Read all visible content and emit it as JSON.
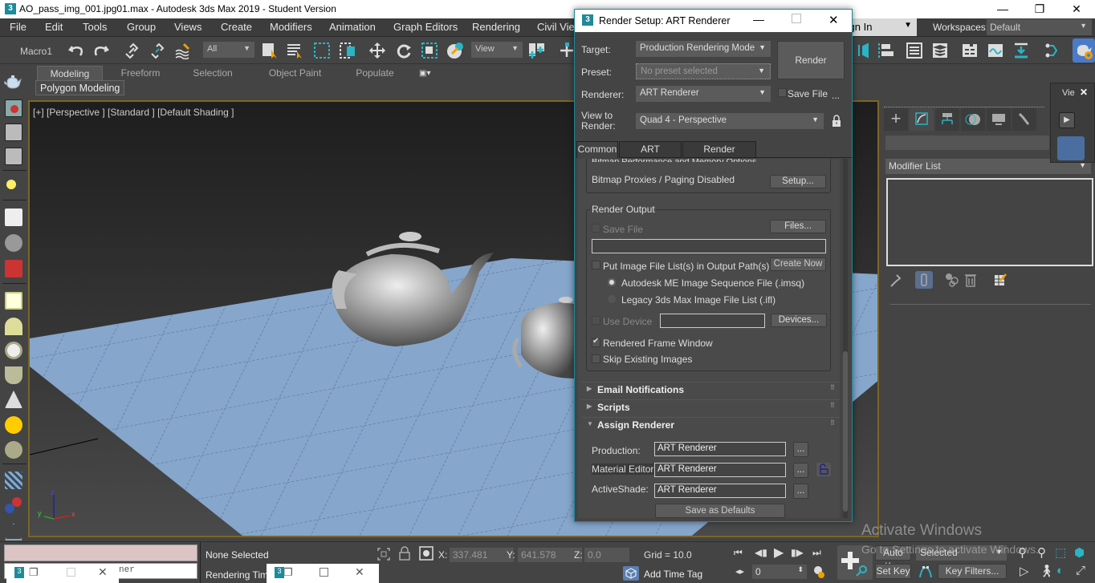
{
  "window": {
    "title": "AO_pass_img_001.jpg01.max - Autodesk 3ds Max 2019 - Student Version",
    "app_icon": "3",
    "minimize": "—",
    "restore": "❐",
    "close": "✕"
  },
  "menubar": {
    "items": [
      "File",
      "Edit",
      "Tools",
      "Group",
      "Views",
      "Create",
      "Modifiers",
      "Animation",
      "Graph Editors",
      "Rendering",
      "Civil View"
    ],
    "sign_in": "Sign In",
    "workspaces_label": "Workspaces:",
    "workspaces_value": "Default"
  },
  "toolbar": {
    "macro_label": "Macro1",
    "selection_filter": "All",
    "ref_coord": "View"
  },
  "ribbon": {
    "tabs": [
      "Modeling",
      "Freeform",
      "Selection",
      "Object Paint",
      "Populate"
    ],
    "active_tab": "Modeling",
    "sub_label": "Polygon Modeling"
  },
  "viewport": {
    "label": "[+] [Perspective ] [Standard ] [Default Shading ]",
    "axis": {
      "x": "x",
      "y": "y",
      "z": "z"
    }
  },
  "command_panel": {
    "tabs": [
      "create",
      "modify",
      "hierarchy",
      "motion",
      "display",
      "utilities"
    ],
    "active_tab": "modify",
    "name_field": "",
    "modifier_list": "Modifier List",
    "viewport_panel_label": "Vie",
    "viewport_panel_close": "✕"
  },
  "render_setup": {
    "title": "Render Setup: ART Renderer",
    "target_label": "Target:",
    "target_value": "Production Rendering Mode",
    "preset_label": "Preset:",
    "preset_value": "No preset selected",
    "renderer_label": "Renderer:",
    "renderer_value": "ART Renderer",
    "save_file_label": "Save File",
    "save_file_checked": false,
    "more": "...",
    "view_label": "View to Render:",
    "view_value": "Quad 4 - Perspective",
    "render_button": "Render",
    "tabs": [
      "Common",
      "ART Renderer",
      "Render Elements"
    ],
    "active_tab": "Common",
    "bitmap_partial": "Bitmap Performance and Memory Options",
    "bitmap_proxies": "Bitmap Proxies / Paging Disabled",
    "setup_button": "Setup...",
    "render_output": {
      "group_label": "Render Output",
      "save_file": "Save File",
      "save_file_checked": false,
      "files_button": "Files...",
      "path_value": "",
      "put_image_list": "Put Image File List(s) in Output Path(s)",
      "put_image_list_checked": false,
      "create_now": "Create Now",
      "radio_imsq": "Autodesk ME Image Sequence File (.imsq)",
      "radio_ifl": "Legacy 3ds Max Image File List (.ifl)",
      "radio_selected": "imsq",
      "use_device": "Use Device",
      "use_device_checked": false,
      "device_value": "",
      "devices_button": "Devices...",
      "rendered_frame_window": "Rendered Frame Window",
      "rendered_frame_window_checked": true,
      "skip_existing": "Skip Existing Images",
      "skip_existing_checked": false
    },
    "rollouts": [
      {
        "label": "Email Notifications",
        "expanded": false
      },
      {
        "label": "Scripts",
        "expanded": false
      },
      {
        "label": "Assign Renderer",
        "expanded": true
      }
    ],
    "assign_renderer": {
      "production_label": "Production:",
      "production_value": "ART Renderer",
      "material_editor_label": "Material Editor:",
      "material_editor_value": "ART Renderer",
      "activeshade_label": "ActiveShade:",
      "activeshade_value": "ART Renderer",
      "browse": "...",
      "save_defaults": "Save as Defaults"
    }
  },
  "statusbar": {
    "maxscript_hint": "ner",
    "selection_status": "None Selected",
    "rendering_time": "Rendering Time",
    "x_label": "X:",
    "x_value": "337.481",
    "y_label": "Y:",
    "y_value": "641.578",
    "z_label": "Z:",
    "z_value": "0.0",
    "grid": "Grid = 10.0",
    "add_time_tag": "Add Time Tag",
    "frame_value": "0",
    "auto_key": "Auto Key",
    "set_key": "Set Key",
    "key_mode": "Selected",
    "key_filters": "Key Filters..."
  },
  "watermark": {
    "line1": "Activate Windows",
    "line2": "Go to Settings to activate Windows."
  },
  "colors": {
    "accent_teal": "#1f9aab",
    "viewport_border": "#7a6628",
    "ground_plane": "#86a6cc"
  }
}
